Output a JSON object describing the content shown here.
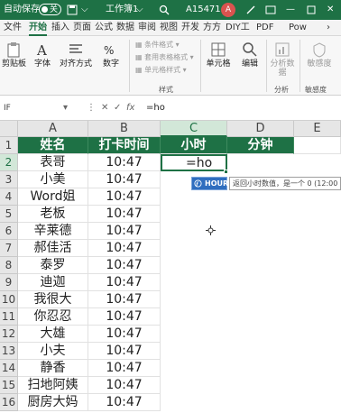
{
  "titlebar": {
    "autosave_label": "自动保存",
    "autosave_state": "关",
    "doc_title": "工作簿1",
    "user_id": "A15471",
    "avatar_letter": "A",
    "accent": "#1e7145"
  },
  "tabs": [
    "文件",
    "开始",
    "插入",
    "页面",
    "公式",
    "数据",
    "审阅",
    "视图",
    "开发",
    "方方",
    "DIY工",
    "PDF",
    "Pow"
  ],
  "active_tab": "开始",
  "ribbon": {
    "clipboard": "剪贴板",
    "font": "字体",
    "align": "对齐方式",
    "number": "数字",
    "cond_format": "条件格式",
    "table_format": "套用表格格式",
    "cell_style": "单元格样式",
    "styles_group": "样式",
    "cells": "单元格",
    "edit": "编辑",
    "analyze_data": "分析数据",
    "analyze_group": "分析",
    "sensitivity": "敏感度",
    "sensitivity_group": "敏感度"
  },
  "formula_bar": {
    "name_box": "IF",
    "cancel": "✕",
    "confirm": "✓",
    "fx": "fx",
    "content": "=ho"
  },
  "columns": [
    "A",
    "B",
    "C",
    "D",
    "E"
  ],
  "rows": [
    "1",
    "2",
    "3",
    "4",
    "5",
    "6",
    "7",
    "8",
    "9",
    "10",
    "11",
    "12",
    "13",
    "14",
    "15",
    "16"
  ],
  "header": {
    "name": "姓名",
    "time": "打卡时间",
    "hour": "小时",
    "minute": "分钟"
  },
  "data_rows": [
    {
      "name": "表哥",
      "time": "10:47"
    },
    {
      "name": "小美",
      "time": "10:47"
    },
    {
      "name": "Word姐",
      "time": "10:47"
    },
    {
      "name": "老板",
      "time": "10:47"
    },
    {
      "name": "辛莱德",
      "time": "10:47"
    },
    {
      "name": "郝佳活",
      "time": "10:47"
    },
    {
      "name": "泰罗",
      "time": "10:47"
    },
    {
      "name": "迪迦",
      "time": "10:47"
    },
    {
      "name": "我很大",
      "time": "10:47"
    },
    {
      "name": "你忍忍",
      "time": "10:47"
    },
    {
      "name": "大雄",
      "time": "10:47"
    },
    {
      "name": "小夫",
      "time": "10:47"
    },
    {
      "name": "静香",
      "time": "10:47"
    },
    {
      "name": "扫地阿姨",
      "time": "10:47"
    },
    {
      "name": "厨房大妈",
      "time": "10:47"
    }
  ],
  "active_cell": {
    "ref": "C2",
    "value": "=ho"
  },
  "autocomplete": {
    "item": "HOUR",
    "tip": "返回小时数值，是一个 0 (12:00"
  }
}
